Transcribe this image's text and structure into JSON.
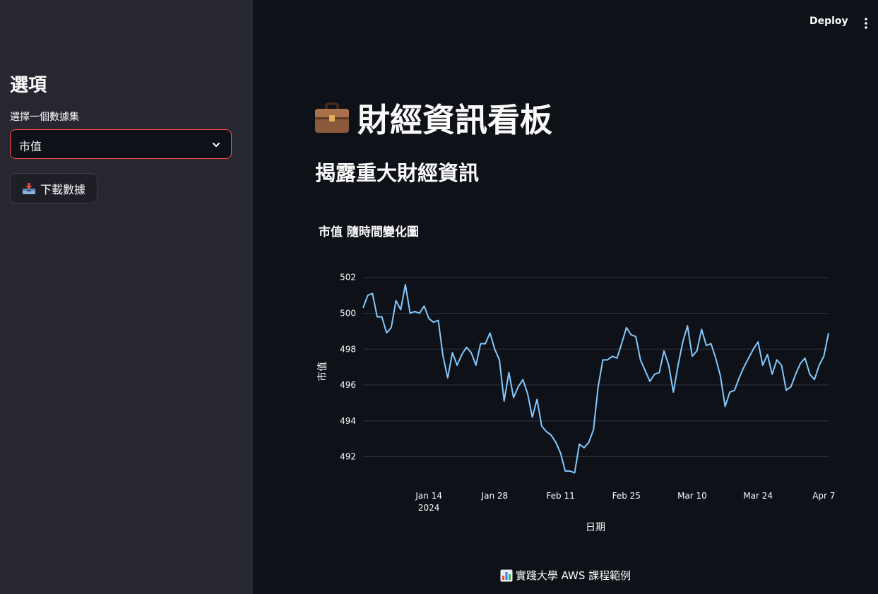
{
  "header": {
    "deploy_label": "Deploy",
    "menu_icon": "more-vertical-icon"
  },
  "sidebar": {
    "title": "選項",
    "select_label": "選擇一個數據集",
    "select_value": "市值",
    "download_label": "下載數據",
    "download_icon": "inbox-tray-icon"
  },
  "main": {
    "title": "財經資訊看板",
    "title_icon": "briefcase-icon",
    "subtitle": "揭露重大財經資訊",
    "chart_title": "市值 隨時間變化圖",
    "footer_text": "實踐大學 AWS 課程範例",
    "footer_icon": "bar-chart-icon"
  },
  "colors": {
    "background": "#0e1117",
    "sidebar": "#262730",
    "accent": "#ff4b4b",
    "line": "#83c9ff",
    "grid": "#31333f"
  },
  "chart_data": {
    "type": "line",
    "xlabel": "日期",
    "ylabel": "市值",
    "ylim": [
      491,
      502.5
    ],
    "yticks": [
      492,
      494,
      496,
      498,
      500,
      502
    ],
    "xticks": [
      {
        "day": 14,
        "label": "Jan 14",
        "sublabel": "2024"
      },
      {
        "day": 28,
        "label": "Jan 28",
        "sublabel": ""
      },
      {
        "day": 42,
        "label": "Feb 11",
        "sublabel": ""
      },
      {
        "day": 56,
        "label": "Feb 25",
        "sublabel": ""
      },
      {
        "day": 70,
        "label": "Mar 10",
        "sublabel": ""
      },
      {
        "day": 84,
        "label": "Mar 24",
        "sublabel": ""
      },
      {
        "day": 98,
        "label": "Apr 7",
        "sublabel": ""
      }
    ],
    "x_start": "2024-01-01",
    "x_end": "2024-04-09",
    "series": [
      {
        "name": "市值",
        "values": [
          500.3,
          501.0,
          501.1,
          499.8,
          499.8,
          498.9,
          499.2,
          500.7,
          500.2,
          501.6,
          500.0,
          500.1,
          500.0,
          500.4,
          499.7,
          499.5,
          499.6,
          497.6,
          496.4,
          497.8,
          497.1,
          497.7,
          498.1,
          497.8,
          497.1,
          498.3,
          498.3,
          498.9,
          498.0,
          497.4,
          495.1,
          496.7,
          495.3,
          495.9,
          496.3,
          495.5,
          494.2,
          495.2,
          493.7,
          493.4,
          493.2,
          492.8,
          492.2,
          491.2,
          491.2,
          491.1,
          492.7,
          492.5,
          492.8,
          493.5,
          495.9,
          497.4,
          497.4,
          497.6,
          497.5,
          498.3,
          499.2,
          498.8,
          498.7,
          497.4,
          496.8,
          496.2,
          496.6,
          496.7,
          497.9,
          497.1,
          495.6,
          497.1,
          498.4,
          499.3,
          497.6,
          497.9,
          499.1,
          498.2,
          498.3,
          497.5,
          496.5,
          494.8,
          495.6,
          495.7,
          496.4,
          497.0,
          497.5,
          498.0,
          498.4,
          497.1,
          497.7,
          496.6,
          497.4,
          497.1,
          495.7,
          495.9,
          496.6,
          497.2,
          497.5,
          496.6,
          496.3,
          497.1,
          497.6,
          498.9
        ]
      }
    ]
  }
}
